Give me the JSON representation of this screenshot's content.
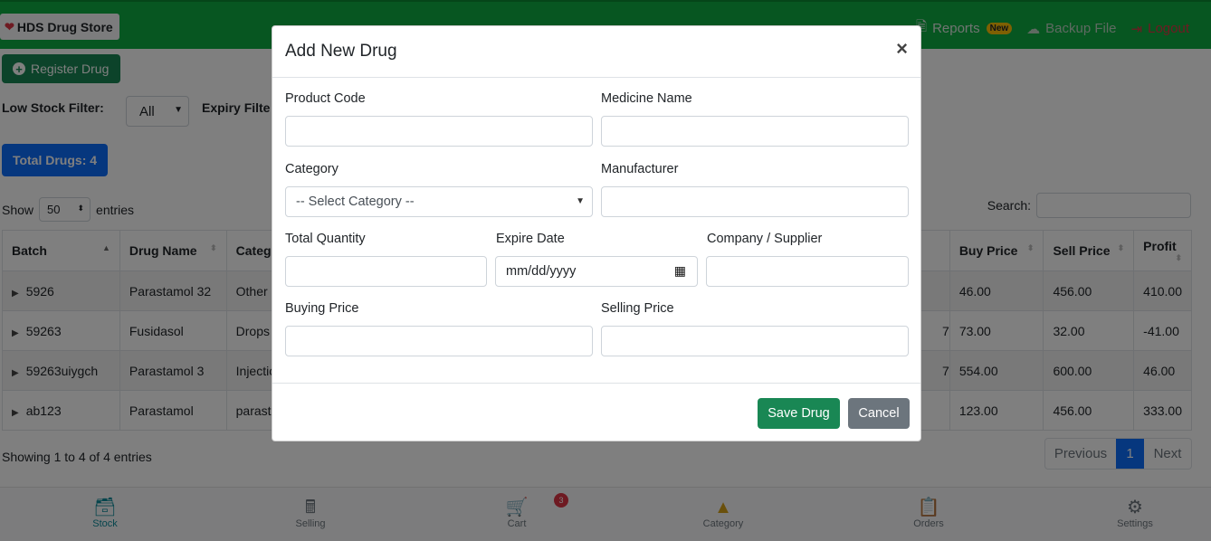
{
  "app": {
    "brand": "HDS Drug Store",
    "nav": {
      "reports": "Reports",
      "reports_badge": "New",
      "backup": "Backup File",
      "logout": "Logout"
    }
  },
  "page": {
    "register_button": "Register Drug",
    "low_stock_label": "Low Stock Filter:",
    "low_stock_value": "All",
    "expiry_label": "Expiry Filte",
    "total_badge": "Total Drugs: 4",
    "show_label": "Show",
    "show_value": "50",
    "entries_label": "entries",
    "search_label": "Search:",
    "table": {
      "headers": [
        "Batch",
        "Drug Name",
        "Categ",
        "Buy Price",
        "Sell Price",
        "Profit"
      ],
      "rows": [
        {
          "batch": "5926",
          "name": "Parastamol 32",
          "category": "Other",
          "extra": "",
          "buy": "46.00",
          "sell": "456.00",
          "profit": "410.00"
        },
        {
          "batch": "59263",
          "name": "Fusidasol",
          "category": "Drops",
          "extra": "7",
          "buy": "73.00",
          "sell": "32.00",
          "profit": "-41.00"
        },
        {
          "batch": "59263uiygch",
          "name": "Parastamol 3",
          "category": "Injectio",
          "extra": "7",
          "buy": "554.00",
          "sell": "600.00",
          "profit": "46.00"
        },
        {
          "batch": "ab123",
          "name": "Parastamol",
          "category": "parast",
          "extra": "",
          "buy": "123.00",
          "sell": "456.00",
          "profit": "333.00"
        }
      ]
    },
    "showing_text": "Showing 1 to 4 of 4 entries",
    "pager": {
      "prev": "Previous",
      "current": "1",
      "next": "Next"
    }
  },
  "bottom_nav": {
    "stock": "Stock",
    "selling": "Selling",
    "cart": "Cart",
    "cart_count": "3",
    "category": "Category",
    "orders": "Orders",
    "settings": "Settings"
  },
  "modal": {
    "title": "Add New Drug",
    "close": "×",
    "product_code_label": "Product Code",
    "medicine_name_label": "Medicine Name",
    "category_label": "Category",
    "category_placeholder": "-- Select Category --",
    "manufacturer_label": "Manufacturer",
    "total_quantity_label": "Total Quantity",
    "expire_date_label": "Expire Date",
    "expire_date_placeholder": "mm/dd/yyyy",
    "supplier_label": "Company / Supplier",
    "buying_price_label": "Buying Price",
    "selling_price_label": "Selling Price",
    "save_button": "Save Drug",
    "cancel_button": "Cancel"
  },
  "colors": {
    "topbar": "#0fad42",
    "primary": "#0d6efd",
    "success": "#198754",
    "danger": "#dc3545",
    "secondary": "#6c757d"
  }
}
